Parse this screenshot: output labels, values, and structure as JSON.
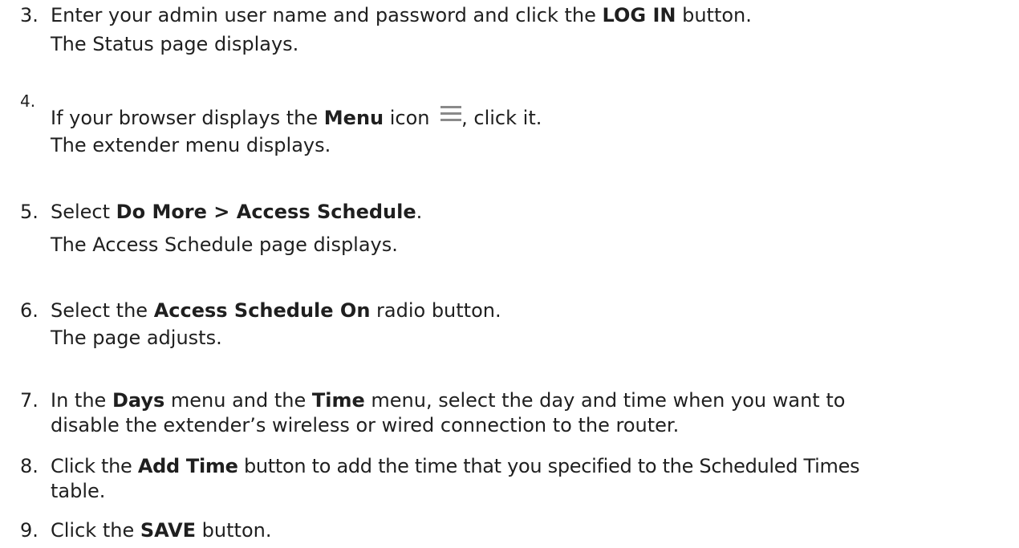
{
  "steps": [
    {
      "number": "3.",
      "text": [
        {
          "t": "Enter your admin user name and password and click the "
        },
        {
          "t": "LOG IN",
          "b": true
        },
        {
          "t": " button."
        }
      ],
      "result": "The Status page displays."
    },
    {
      "number": "4.",
      "text_before": "If your browser displays the ",
      "bold": "Menu",
      "text_mid": " icon ",
      "icon": "menu-hamburger-icon",
      "text_after": ", click it.",
      "result": "The extender menu displays."
    },
    {
      "number": "5.",
      "text": [
        {
          "t": "Select "
        },
        {
          "t": "Do More > Access Schedule",
          "b": true
        },
        {
          "t": "."
        }
      ],
      "result": "The Access Schedule page displays."
    },
    {
      "number": "6.",
      "text": [
        {
          "t": "Select the "
        },
        {
          "t": "Access Schedule On",
          "b": true
        },
        {
          "t": " radio button."
        }
      ],
      "result": "The page adjusts."
    },
    {
      "number": "7.",
      "text": [
        {
          "t": "In the "
        },
        {
          "t": "Days",
          "b": true
        },
        {
          "t": " menu and the "
        },
        {
          "t": "Time",
          "b": true
        },
        {
          "t": " menu, select the day and time when you want to"
        }
      ],
      "continuation": "disable the extender’s wireless or wired connection to the router."
    },
    {
      "number": "8.",
      "text": [
        {
          "t": "Click the "
        },
        {
          "t": "Add Time",
          "b": true
        },
        {
          "t": " button to add the time that you specified to the Scheduled Times"
        }
      ],
      "continuation": "table."
    },
    {
      "number": "9.",
      "text": [
        {
          "t": "Click the "
        },
        {
          "t": "SAVE",
          "b": true
        },
        {
          "t": " button."
        }
      ]
    }
  ],
  "colors": {
    "text": "#1f1f1f",
    "icon": "#8a8a8a"
  }
}
